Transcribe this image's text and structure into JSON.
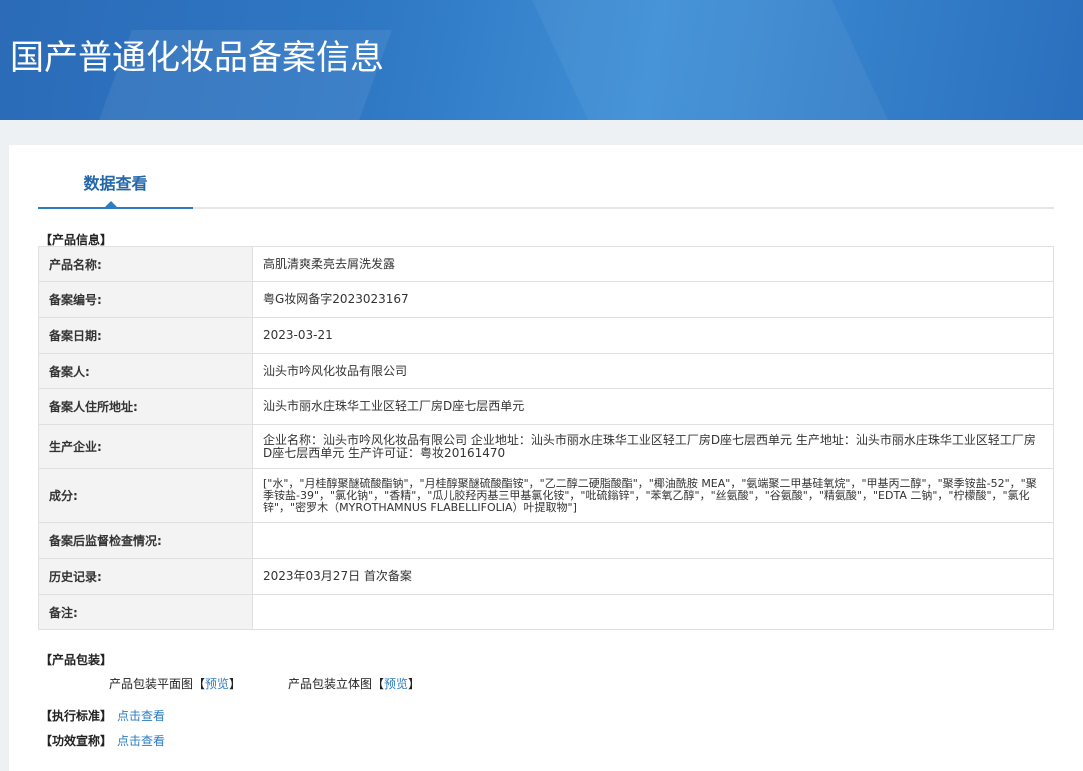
{
  "header": {
    "title": "国产普通化妆品备案信息"
  },
  "tabs": [
    {
      "label": "数据查看"
    }
  ],
  "product_info": {
    "section_title": "【产品信息】",
    "rows": [
      {
        "label": "产品名称:",
        "value": "高肌清爽柔亮去屑洗发露"
      },
      {
        "label": "备案编号:",
        "value": "粤G妆网备字2023023167"
      },
      {
        "label": "备案日期:",
        "value": "2023-03-21"
      },
      {
        "label": "备案人:",
        "value": "汕头市吟风化妆品有限公司"
      },
      {
        "label": "备案人住所地址:",
        "value": "汕头市丽水庄珠华工业区轻工厂房D座七层西单元"
      },
      {
        "label": "生产企业:",
        "value": "企业名称：汕头市吟风化妆品有限公司 企业地址：汕头市丽水庄珠华工业区轻工厂房D座七层西单元 生产地址：汕头市丽水庄珠华工业区轻工厂房D座七层西单元 生产许可证：粤妆20161470"
      },
      {
        "label": "成分:",
        "value": "[\"水\"，\"月桂醇聚醚硫酸酯钠\"，\"月桂醇聚醚硫酸酯铵\"，\"乙二醇二硬脂酸酯\"，\"椰油酰胺 MEA\"，\"氨端聚二甲基硅氧烷\"，\"甲基丙二醇\"，\"聚季铵盐-52\"，\"聚季铵盐-39\"，\"氯化钠\"，\"香精\"，\"瓜儿胶羟丙基三甲基氯化铵\"，\"吡硫鎓锌\"，\"苯氧乙醇\"，\"丝氨酸\"，\"谷氨酸\"，\"精氨酸\"，\"EDTA 二钠\"，\"柠檬酸\"，\"氯化锌\"，\"密罗木（MYROTHAMNUS FLABELLIFOLIA）叶提取物\"]"
      },
      {
        "label": "备案后监督检查情况:",
        "value": ""
      },
      {
        "label": "历史记录:",
        "value": "2023年03月27日 首次备案"
      },
      {
        "label": "备注:",
        "value": ""
      }
    ]
  },
  "packaging": {
    "section_title": "【产品包装】",
    "flat_label": "产品包装平面图",
    "flat_open": "【",
    "flat_link": "预览",
    "flat_close": "】",
    "solid_label": "产品包装立体图",
    "solid_open": "【",
    "solid_link": "预览",
    "solid_close": "】"
  },
  "standard": {
    "title": "【执行标准】",
    "link": "点击查看"
  },
  "efficacy": {
    "title": "【功效宣称】",
    "link": "点击查看"
  }
}
